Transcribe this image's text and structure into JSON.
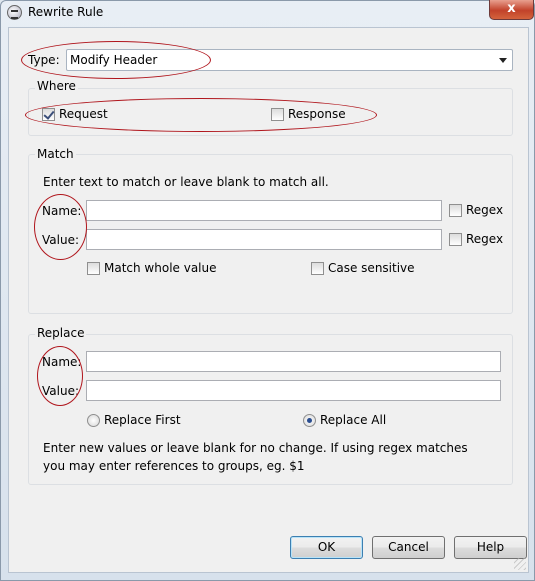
{
  "window": {
    "title": "Rewrite Rule",
    "close_glyph": "x"
  },
  "type": {
    "label": "Type:",
    "selected": "Modify Header"
  },
  "where": {
    "legend": "Where",
    "request": {
      "label": "Request",
      "checked": true
    },
    "response": {
      "label": "Response",
      "checked": false
    }
  },
  "match": {
    "legend": "Match",
    "instructions": "Enter text to match or leave blank to match all.",
    "name_label": "Name:",
    "name_value": "",
    "name_regex_label": "Regex",
    "value_label": "Value:",
    "value_value": "",
    "value_regex_label": "Regex",
    "whole_value_label": "Match whole value",
    "case_sensitive_label": "Case sensitive"
  },
  "replace": {
    "legend": "Replace",
    "name_label": "Name:",
    "name_value": "",
    "value_label": "Value:",
    "value_value": "",
    "replace_first_label": "Replace First",
    "replace_all_label": "Replace All",
    "selected_mode": "Replace All",
    "help_text": "Enter new values or leave blank for no change. If using regex matches you may enter references to groups, eg. $1"
  },
  "buttons": {
    "ok": "OK",
    "cancel": "Cancel",
    "help": "Help"
  },
  "colors": {
    "annotation": "#b0161d",
    "focus_border": "#3c7fb1"
  }
}
